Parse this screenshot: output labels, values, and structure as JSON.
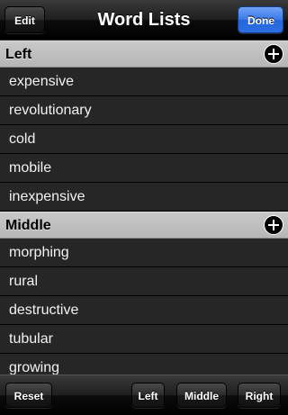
{
  "navbar": {
    "title": "Word Lists",
    "edit_label": "Edit",
    "done_label": "Done"
  },
  "sections": [
    {
      "title": "Left",
      "add_icon": "plus-circle-icon",
      "items": [
        "expensive",
        "revolutionary",
        "cold",
        "mobile",
        "inexpensive"
      ]
    },
    {
      "title": "Middle",
      "add_icon": "plus-circle-icon",
      "items": [
        "morphing",
        "rural",
        "destructive",
        "tubular",
        "growing"
      ]
    }
  ],
  "toolbar": {
    "reset_label": "Reset",
    "left_label": "Left",
    "middle_label": "Middle",
    "right_label": "Right"
  },
  "colors": {
    "done_button": "#2b6fe3",
    "section_header": "#b6b6b6",
    "row_background": "#262626"
  }
}
